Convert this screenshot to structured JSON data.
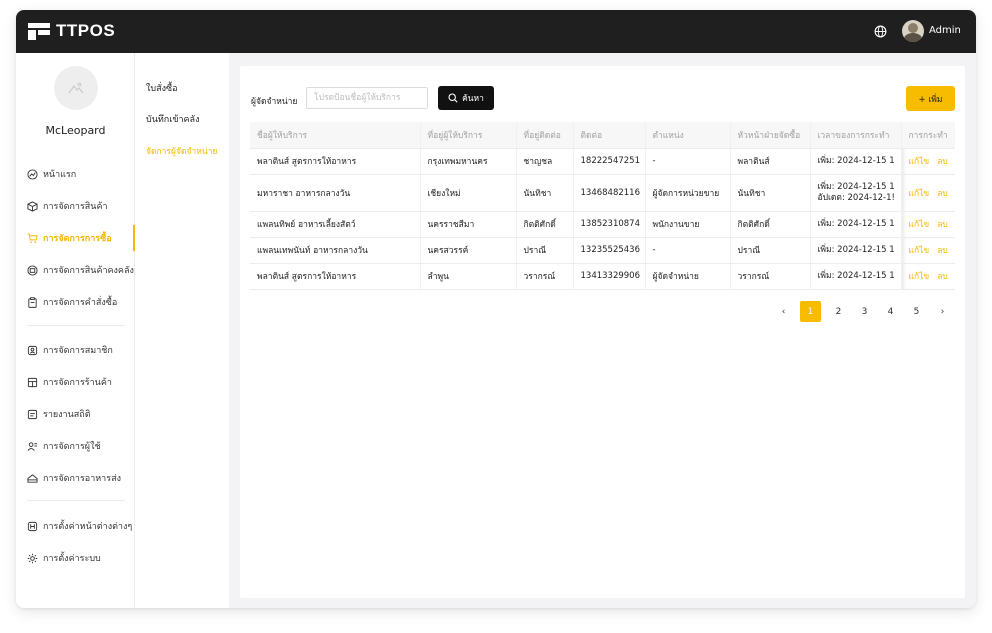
{
  "app": {
    "logo_text": "TTPOS",
    "user_name": "Admin"
  },
  "sidebar": {
    "username": "McLeopard",
    "items": [
      {
        "label": "หน้าแรก",
        "icon": "dashboard-icon"
      },
      {
        "label": "การจัดการสินค้า",
        "icon": "box-icon"
      },
      {
        "label": "การจัดการการซื้อ",
        "icon": "cart-icon",
        "active": true
      },
      {
        "label": "การจัดการสินค้าคงคลัง",
        "icon": "warehouse-icon"
      },
      {
        "label": "การจัดการคำสั่งซื้อ",
        "icon": "clipboard-icon"
      },
      {
        "label": "การจัดการสมาชิก",
        "icon": "member-icon"
      },
      {
        "label": "การจัดการร้านค้า",
        "icon": "store-icon"
      },
      {
        "label": "รายงานสถิติ",
        "icon": "report-icon"
      },
      {
        "label": "การจัดการผู้ใช้",
        "icon": "users-icon"
      },
      {
        "label": "การจัดการอาหารส่ง",
        "icon": "delivery-icon"
      },
      {
        "label": "การตั้งค่าหน้าต่างต่างๆ",
        "icon": "window-settings-icon"
      },
      {
        "label": "การตั้งค่าระบบ",
        "icon": "gear-icon"
      }
    ]
  },
  "subnav": {
    "items": [
      {
        "label": "ใบสั่งซื้อ"
      },
      {
        "label": "บันทึกเข้าคลัง"
      },
      {
        "label": "จัดการผู้จัดจำหน่าย",
        "active": true
      }
    ]
  },
  "search": {
    "label": "ผู้จัดจำหน่าย",
    "placeholder": "โปรดป้อนชื่อผู้ให้บริการ",
    "button": "ค้นหา",
    "add_button": "+ เพิ่ม"
  },
  "table": {
    "columns": [
      "ชื่อผู้ให้บริการ",
      "ที่อยู่ผู้ให้บริการ",
      "ที่อยู่ติดต่อ",
      "ติดต่อ",
      "ตำแหน่ง",
      "หัวหน้าฝ่ายจัดซื้อ",
      "เวลาของการกระทำ",
      "การกระทำ"
    ],
    "edit_label": "แก้ไข",
    "delete_label": "ลบ",
    "rows": [
      {
        "name": "พลาตินส์ สูตรการให้อาหาร",
        "address": "กรุงเทพมหานคร",
        "contact_addr": "ชาญชล",
        "phone": "18222547251",
        "position": "-",
        "head": "พลาตินส์",
        "time1": "เพิ่ม:  2024-12-15 1",
        "time2": ""
      },
      {
        "name": "มหาราชา อาหารกลางวัน",
        "address": "เชียงใหม่",
        "contact_addr": "นันทิชา",
        "phone": "13468482116",
        "position": "ผู้จัดการหน่วยขาย",
        "head": "นันทิชา",
        "time1": "เพิ่ม:  2024-12-15 1",
        "time2": "อัปเดต:  2024-12-1!"
      },
      {
        "name": "แพลนทิพย์ อาหารเลี้ยงสัตว์",
        "address": "นครราชสีมา",
        "contact_addr": "กิตติศักดิ์",
        "phone": "13852310874",
        "position": "พนักงานขาย",
        "head": "กิตติศักดิ์",
        "time1": "เพิ่ม:  2024-12-15 1",
        "time2": ""
      },
      {
        "name": "แพลนเทพนันท์ อาหารกลางวัน",
        "address": "นครสวรรค์",
        "contact_addr": "ปราณี",
        "phone": "13235525436",
        "position": "-",
        "head": "ปราณี",
        "time1": "เพิ่ม:  2024-12-15 1",
        "time2": ""
      },
      {
        "name": "พลาตินส์ สูตรการให้อาหาร",
        "address": "ลำพูน",
        "contact_addr": "วรากรณ์",
        "phone": "13413329906",
        "position": "ผู้จัดจำหน่าย",
        "head": "วรากรณ์",
        "time1": "เพิ่ม:  2024-12-15 1",
        "time2": ""
      }
    ]
  },
  "pagination": {
    "prev": "‹",
    "next": "›",
    "pages": [
      "1",
      "2",
      "3",
      "4",
      "5"
    ],
    "current": "1"
  },
  "colors": {
    "accent": "#f7bb00",
    "topbar": "#1f1f1f"
  }
}
